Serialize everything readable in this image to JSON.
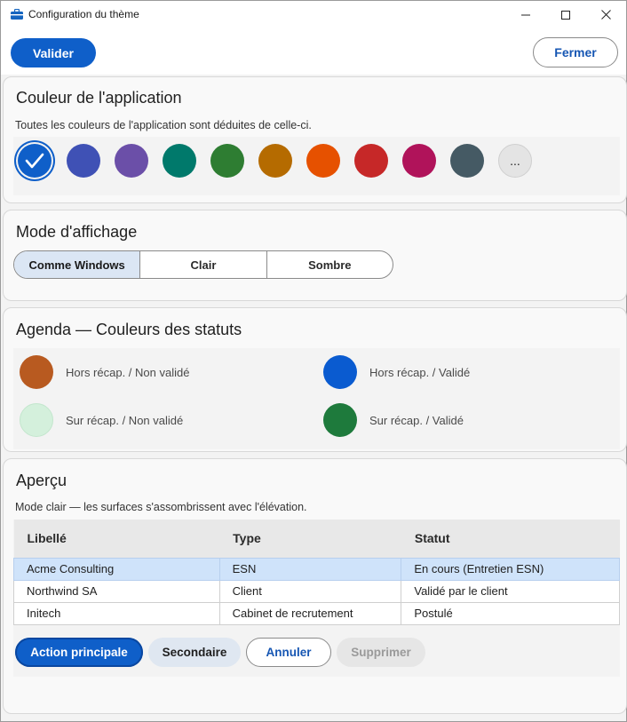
{
  "window": {
    "title": "Configuration du thème",
    "icon": "toolbox-icon"
  },
  "toolbar": {
    "validate_label": "Valider",
    "close_label": "Fermer"
  },
  "app_color": {
    "title": "Couleur de l'application",
    "subtitle": "Toutes les couleurs de l'application sont déduites de celle-ci.",
    "swatches": [
      "#0f5fc9",
      "#3f51b5",
      "#6b4fa8",
      "#00796b",
      "#2e7d32",
      "#b56b00",
      "#e65100",
      "#c62828",
      "#b0135a",
      "#455a64"
    ],
    "selected_index": 0,
    "more_label": "..."
  },
  "display_mode": {
    "title": "Mode d'affichage",
    "options": [
      "Comme Windows",
      "Clair",
      "Sombre"
    ],
    "selected": "Comme Windows"
  },
  "agenda": {
    "title": "Agenda — Couleurs des statuts",
    "statuses": [
      {
        "label": "Hors récap. / Non validé",
        "color": "#b85a20"
      },
      {
        "label": "Hors récap. / Validé",
        "color": "#0a5bd0"
      },
      {
        "label": "Sur récap. / Non validé",
        "color": "#d4f0dc"
      },
      {
        "label": "Sur récap. / Validé",
        "color": "#1e7a3c"
      }
    ]
  },
  "preview": {
    "title": "Aperçu",
    "subtitle": "Mode clair — les surfaces s'assombrissent avec l'élévation.",
    "columns": [
      "Libellé",
      "Type",
      "Statut"
    ],
    "rows": [
      [
        "Acme Consulting",
        "ESN",
        "En cours (Entretien ESN)"
      ],
      [
        "Northwind SA",
        "Client",
        "Validé par le client"
      ],
      [
        "Initech",
        "Cabinet de recrutement",
        "Postulé"
      ]
    ],
    "selected_row": 0,
    "buttons": {
      "primary": "Action principale",
      "secondary": "Secondaire",
      "cancel": "Annuler",
      "delete": "Supprimer"
    }
  }
}
